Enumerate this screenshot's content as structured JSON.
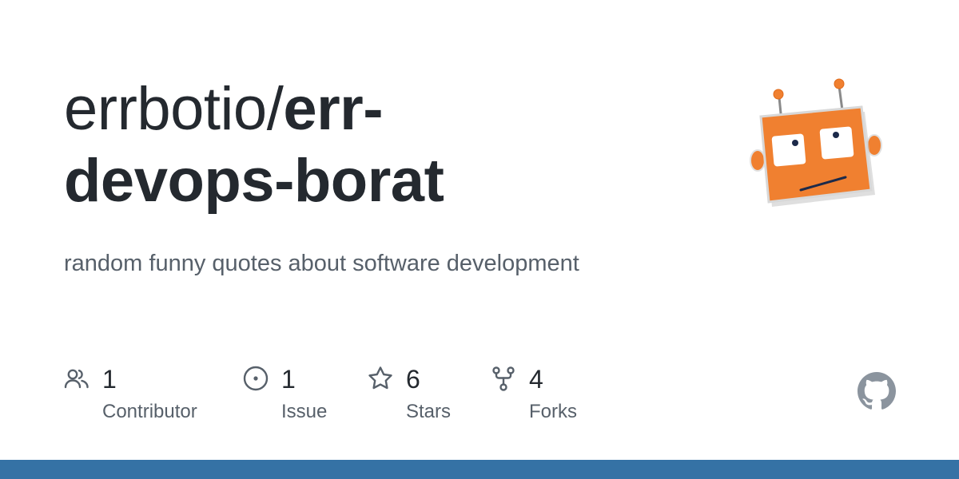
{
  "repo": {
    "owner": "errbotio/",
    "name_line1": "err-",
    "name_line2": "devops-borat",
    "description": "random funny quotes about software development"
  },
  "stats": [
    {
      "icon": "people-icon",
      "value": "1",
      "label": "Contributor"
    },
    {
      "icon": "issue-icon",
      "value": "1",
      "label": "Issue"
    },
    {
      "icon": "star-icon",
      "value": "6",
      "label": "Stars"
    },
    {
      "icon": "fork-icon",
      "value": "4",
      "label": "Forks"
    }
  ],
  "colors": {
    "title": "#24292f",
    "muted": "#57606a",
    "icon": "#57606a",
    "github_mark": "#8b949e",
    "language_bar": "#3572a5",
    "robot_body": "#f08030"
  },
  "icons": {
    "avatar": "robot-avatar",
    "brand": "github-mark-icon"
  }
}
